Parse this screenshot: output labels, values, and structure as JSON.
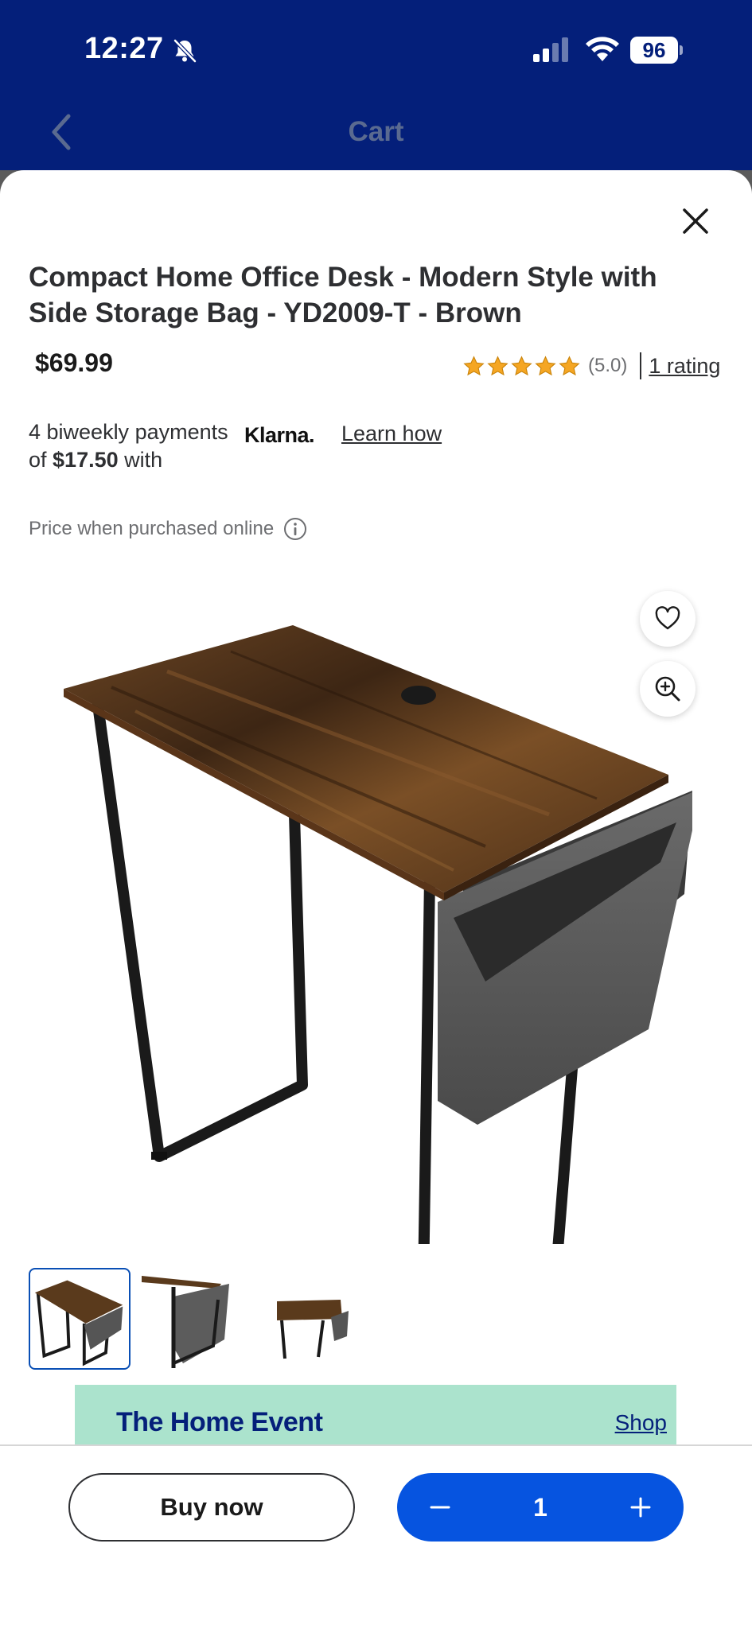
{
  "status_bar": {
    "time": "12:27",
    "battery": "96"
  },
  "nav": {
    "title": "Cart"
  },
  "product": {
    "title": "Compact Home Office Desk - Modern Style with Side Storage Bag - YD2009-T - Brown",
    "price": "$69.99",
    "rating": {
      "score": "(5.0)",
      "stars": 5,
      "count_label": "1 rating"
    },
    "klarna": {
      "text_before": "4 biweekly payments of ",
      "amount": "$17.50",
      "text_after": " with",
      "logo": "Klarna.",
      "learn_label": "Learn how"
    },
    "price_note": "Price when purchased online",
    "thumbnail_count": 3,
    "selected_thumbnail": 1
  },
  "promo": {
    "title": "The Home Event",
    "link": "Shop"
  },
  "actions": {
    "buy_now_label": "Buy now",
    "quantity": "1"
  },
  "colors": {
    "brand_blue": "#041f7a",
    "action_blue": "#0654e0",
    "promo_mint": "#abe3cd",
    "star": "#f5a623"
  },
  "icons": [
    "bell-off-icon",
    "signal-icon",
    "wifi-icon",
    "back-chevron-icon",
    "close-icon",
    "star-icon",
    "info-icon",
    "heart-icon",
    "zoom-in-icon",
    "minus-icon",
    "plus-icon"
  ]
}
